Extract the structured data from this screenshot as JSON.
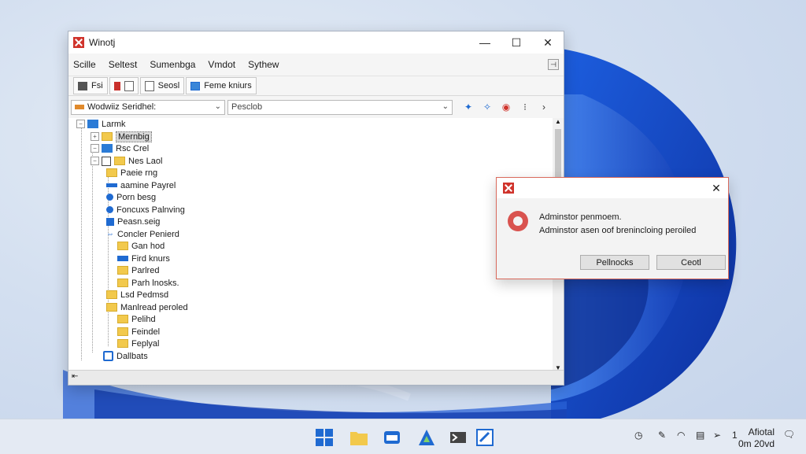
{
  "window": {
    "title": "Winotj",
    "minimize_glyph": "—",
    "maximize_glyph": "☐",
    "close_glyph": "✕"
  },
  "menu": [
    "Scille",
    "Seltest",
    "Sumenbga",
    "Vmdot",
    "Sythew"
  ],
  "toolbar": [
    {
      "label": "Fsi",
      "icon": "tools-icon"
    },
    {
      "label": "",
      "icon": "edit-icon"
    },
    {
      "label": "Seosl",
      "icon": "window-icon"
    },
    {
      "label": "Feme kniurs",
      "icon": "monitor-icon"
    }
  ],
  "address": {
    "location": "Wodwiiz Seridhel:",
    "search_placeholder": "Pesclob",
    "nav_icons": [
      "pin-icon",
      "pin-alt-icon",
      "view-icon",
      "more-icon",
      "next-icon"
    ]
  },
  "tree": [
    {
      "label": "Larmk",
      "icon": "blue",
      "expander": "-",
      "selected": false
    },
    {
      "label": "Mernbig",
      "icon": "folder",
      "expander": "+",
      "selected": true
    },
    {
      "label": "Rsc Crel",
      "icon": "blue",
      "expander": "-",
      "selected": false
    },
    {
      "label": "Nes Laol",
      "icon": "check",
      "expander": "-",
      "selected": false
    },
    {
      "label": "Paeie rng",
      "icon": "folder",
      "expander": "",
      "selected": false
    },
    {
      "label": "aamine Payrel",
      "icon": "arrow",
      "expander": "",
      "selected": false
    },
    {
      "label": "Porn besg",
      "icon": "dot",
      "expander": "",
      "selected": false
    },
    {
      "label": "Foncuxs Palnving",
      "icon": "dot",
      "expander": "",
      "selected": false
    },
    {
      "label": "Peasn.seig",
      "icon": "check",
      "expander": "",
      "selected": false
    },
    {
      "label": "Concler Penierd",
      "icon": "link",
      "expander": "",
      "selected": false
    },
    {
      "label": "Gan hod",
      "icon": "folder",
      "expander": "",
      "selected": false
    },
    {
      "label": "Fird knurs",
      "icon": "arrow",
      "expander": "",
      "selected": false
    },
    {
      "label": "Parlred",
      "icon": "folder-arrow",
      "expander": "",
      "selected": false
    },
    {
      "label": "Parh lnosks.",
      "icon": "folder-arrow",
      "expander": "",
      "selected": false
    },
    {
      "label": "Lsd Pedmsd",
      "icon": "folder",
      "expander": "",
      "selected": false
    },
    {
      "label": "Manlread peroled",
      "icon": "folder",
      "expander": "",
      "selected": false
    },
    {
      "label": "Pelihd",
      "icon": "folder",
      "expander": "",
      "selected": false
    },
    {
      "label": "Feindel",
      "icon": "folder-arrow",
      "expander": "",
      "selected": false
    },
    {
      "label": "Feplyal",
      "icon": "folder-arrow",
      "expander": "",
      "selected": false
    },
    {
      "label": "Dallbats",
      "icon": "shield",
      "expander": "",
      "selected": false
    }
  ],
  "dialog": {
    "close_glyph": "✕",
    "line1": "Adminstor penmoem.",
    "line2": "Adminstor asen oof brenincloing peroiled",
    "button1": "Pellnocks",
    "button2": "Ceotl"
  },
  "taskbar": {
    "apps": [
      "windows-start-icon",
      "file-explorer-icon",
      "mail-icon",
      "store-icon",
      "terminal-icon",
      "app-icon"
    ],
    "tray_count": "1",
    "clock_line1": "Afiotal",
    "clock_line2": "0m 20vd"
  },
  "colors": {
    "accent": "#1f6ad1",
    "app_icon": "#d0342c",
    "folder": "#f2c94c",
    "warning": "#d9534f"
  }
}
